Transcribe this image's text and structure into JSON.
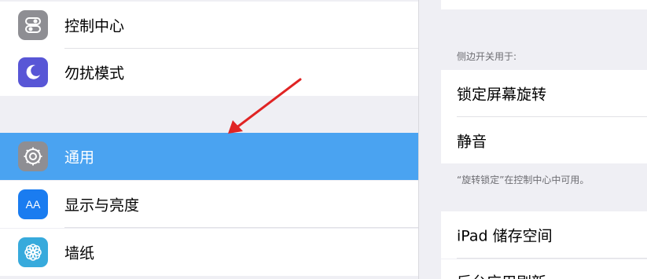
{
  "sidebar": {
    "items": [
      {
        "label": "控制中心",
        "icon": "control-center-icon",
        "color": "#8e8e93"
      },
      {
        "label": "勿扰模式",
        "icon": "moon-icon",
        "color": "#5856d6"
      },
      {
        "label": "通用",
        "icon": "gear-icon",
        "color": "#8e8e93",
        "selected": true
      },
      {
        "label": "显示与亮度",
        "icon": "display-brightness-icon",
        "color": "#1a7cf0",
        "icon_text": "AA"
      },
      {
        "label": "墙纸",
        "icon": "wallpaper-icon",
        "color": "#37aadc"
      }
    ],
    "selected_color": "#4aa3f1"
  },
  "detail": {
    "section_header": "侧边开关用于:",
    "options": [
      "锁定屏幕旋转",
      "静音"
    ],
    "footer_note": "“旋转锁定”在控制中心中可用。",
    "storage_label": "iPad 储存空间",
    "next_item_label": "后台应用刷新"
  },
  "annotation": {
    "color": "#e02424",
    "kind": "arrow",
    "points_to": "通用"
  }
}
